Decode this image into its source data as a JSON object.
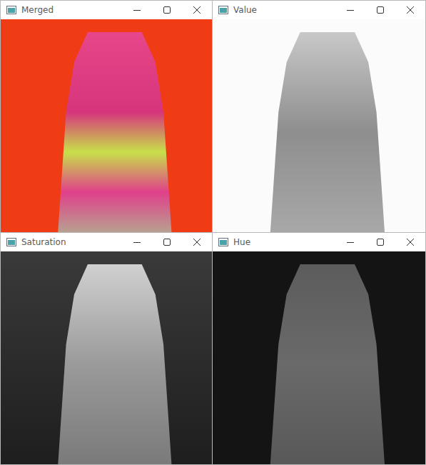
{
  "windows": [
    {
      "title": "Merged"
    },
    {
      "title": "Value"
    },
    {
      "title": "Saturation"
    },
    {
      "title": "Hue"
    }
  ]
}
